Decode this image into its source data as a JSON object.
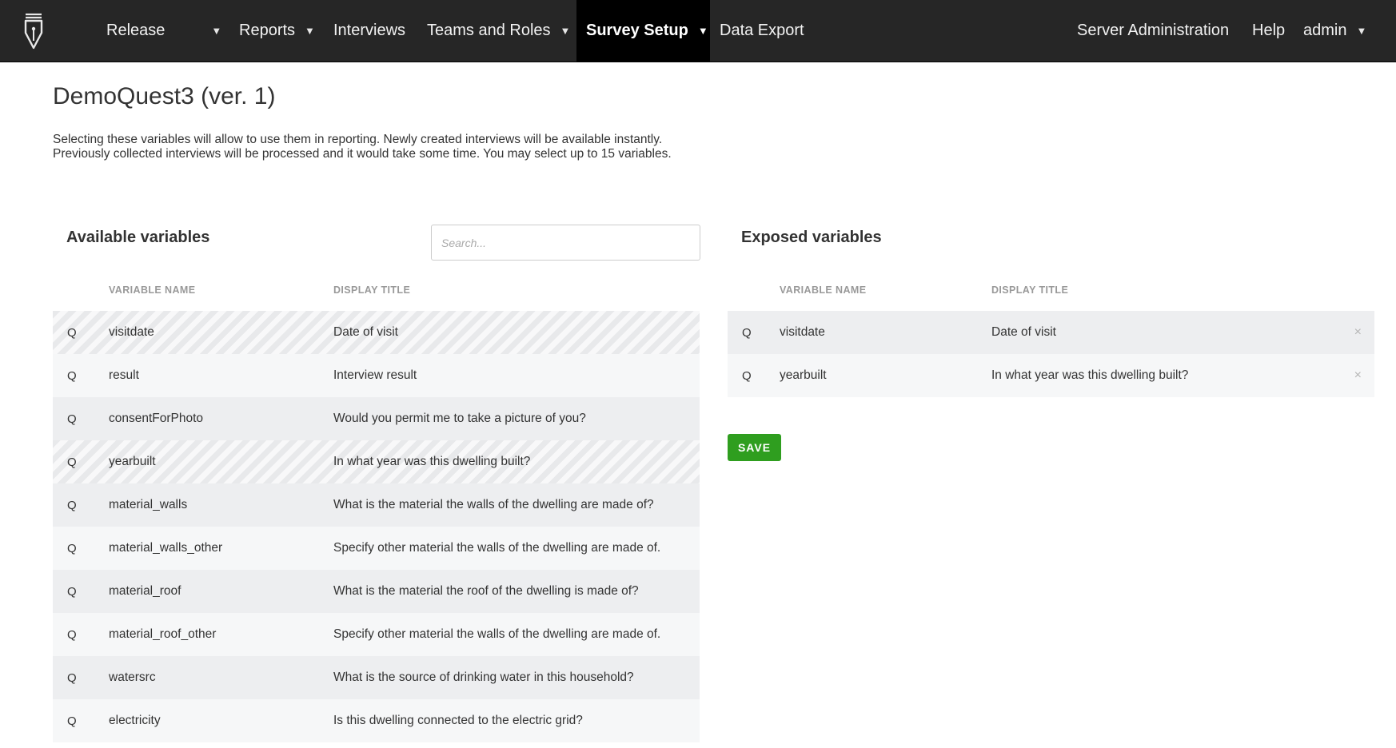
{
  "nav": {
    "logo_icon": "pen-nib-logo-icon",
    "items": [
      {
        "label": "Release",
        "has_caret": true
      },
      {
        "label": "Reports",
        "has_caret": true
      },
      {
        "label": "Interviews",
        "has_caret": false
      },
      {
        "label": "Teams and Roles",
        "has_caret": true
      },
      {
        "label": "Survey Setup",
        "has_caret": true,
        "active": true
      },
      {
        "label": "Data Export",
        "has_caret": false
      }
    ],
    "right_items": [
      {
        "label": "Server Administration",
        "has_caret": false
      },
      {
        "label": "Help",
        "has_caret": false
      },
      {
        "label": "admin",
        "has_caret": true
      }
    ],
    "caret_glyph": "▼"
  },
  "page": {
    "title": "DemoQuest3 (ver. 1)",
    "description_line1": "Selecting these variables will allow to use them in reporting. Newly created interviews will be available instantly.",
    "description_line2": "Previously collected interviews will be processed and it would take some time. You may select up to 15 variables."
  },
  "available": {
    "title": "Available variables",
    "search_placeholder": "Search...",
    "col_name": "VARIABLE NAME",
    "col_title": "DISPLAY TITLE",
    "rows": [
      {
        "type": "Q",
        "name": "visitdate",
        "title": "Date of visit",
        "selected": true
      },
      {
        "type": "Q",
        "name": "result",
        "title": "Interview result",
        "selected": false
      },
      {
        "type": "Q",
        "name": "consentForPhoto",
        "title": "Would you permit me to take a picture of you?",
        "selected": false
      },
      {
        "type": "Q",
        "name": "yearbuilt",
        "title": "In what year was this dwelling built?",
        "selected": true
      },
      {
        "type": "Q",
        "name": "material_walls",
        "title": "What is the material the walls of the dwelling are made of?",
        "selected": false
      },
      {
        "type": "Q",
        "name": "material_walls_other",
        "title": "Specify other material the walls of the dwelling are made of.",
        "selected": false
      },
      {
        "type": "Q",
        "name": "material_roof",
        "title": "What is the material the roof of the dwelling is made of?",
        "selected": false
      },
      {
        "type": "Q",
        "name": "material_roof_other",
        "title": "Specify other material the walls of the dwelling are made of.",
        "selected": false
      },
      {
        "type": "Q",
        "name": "watersrc",
        "title": "What is the source of drinking water in this household?",
        "selected": false
      },
      {
        "type": "Q",
        "name": "electricity",
        "title": "Is this dwelling connected to the electric grid?",
        "selected": false
      }
    ]
  },
  "exposed": {
    "title": "Exposed variables",
    "col_name": "VARIABLE NAME",
    "col_title": "DISPLAY TITLE",
    "remove_glyph": "×",
    "rows": [
      {
        "type": "Q",
        "name": "visitdate",
        "title": "Date of visit"
      },
      {
        "type": "Q",
        "name": "yearbuilt",
        "title": "In what year was this dwelling built?"
      }
    ],
    "save_label": "SAVE"
  },
  "colors": {
    "navbar": "#262626",
    "active_nav": "#000000",
    "save_button": "#2f9e1f"
  }
}
